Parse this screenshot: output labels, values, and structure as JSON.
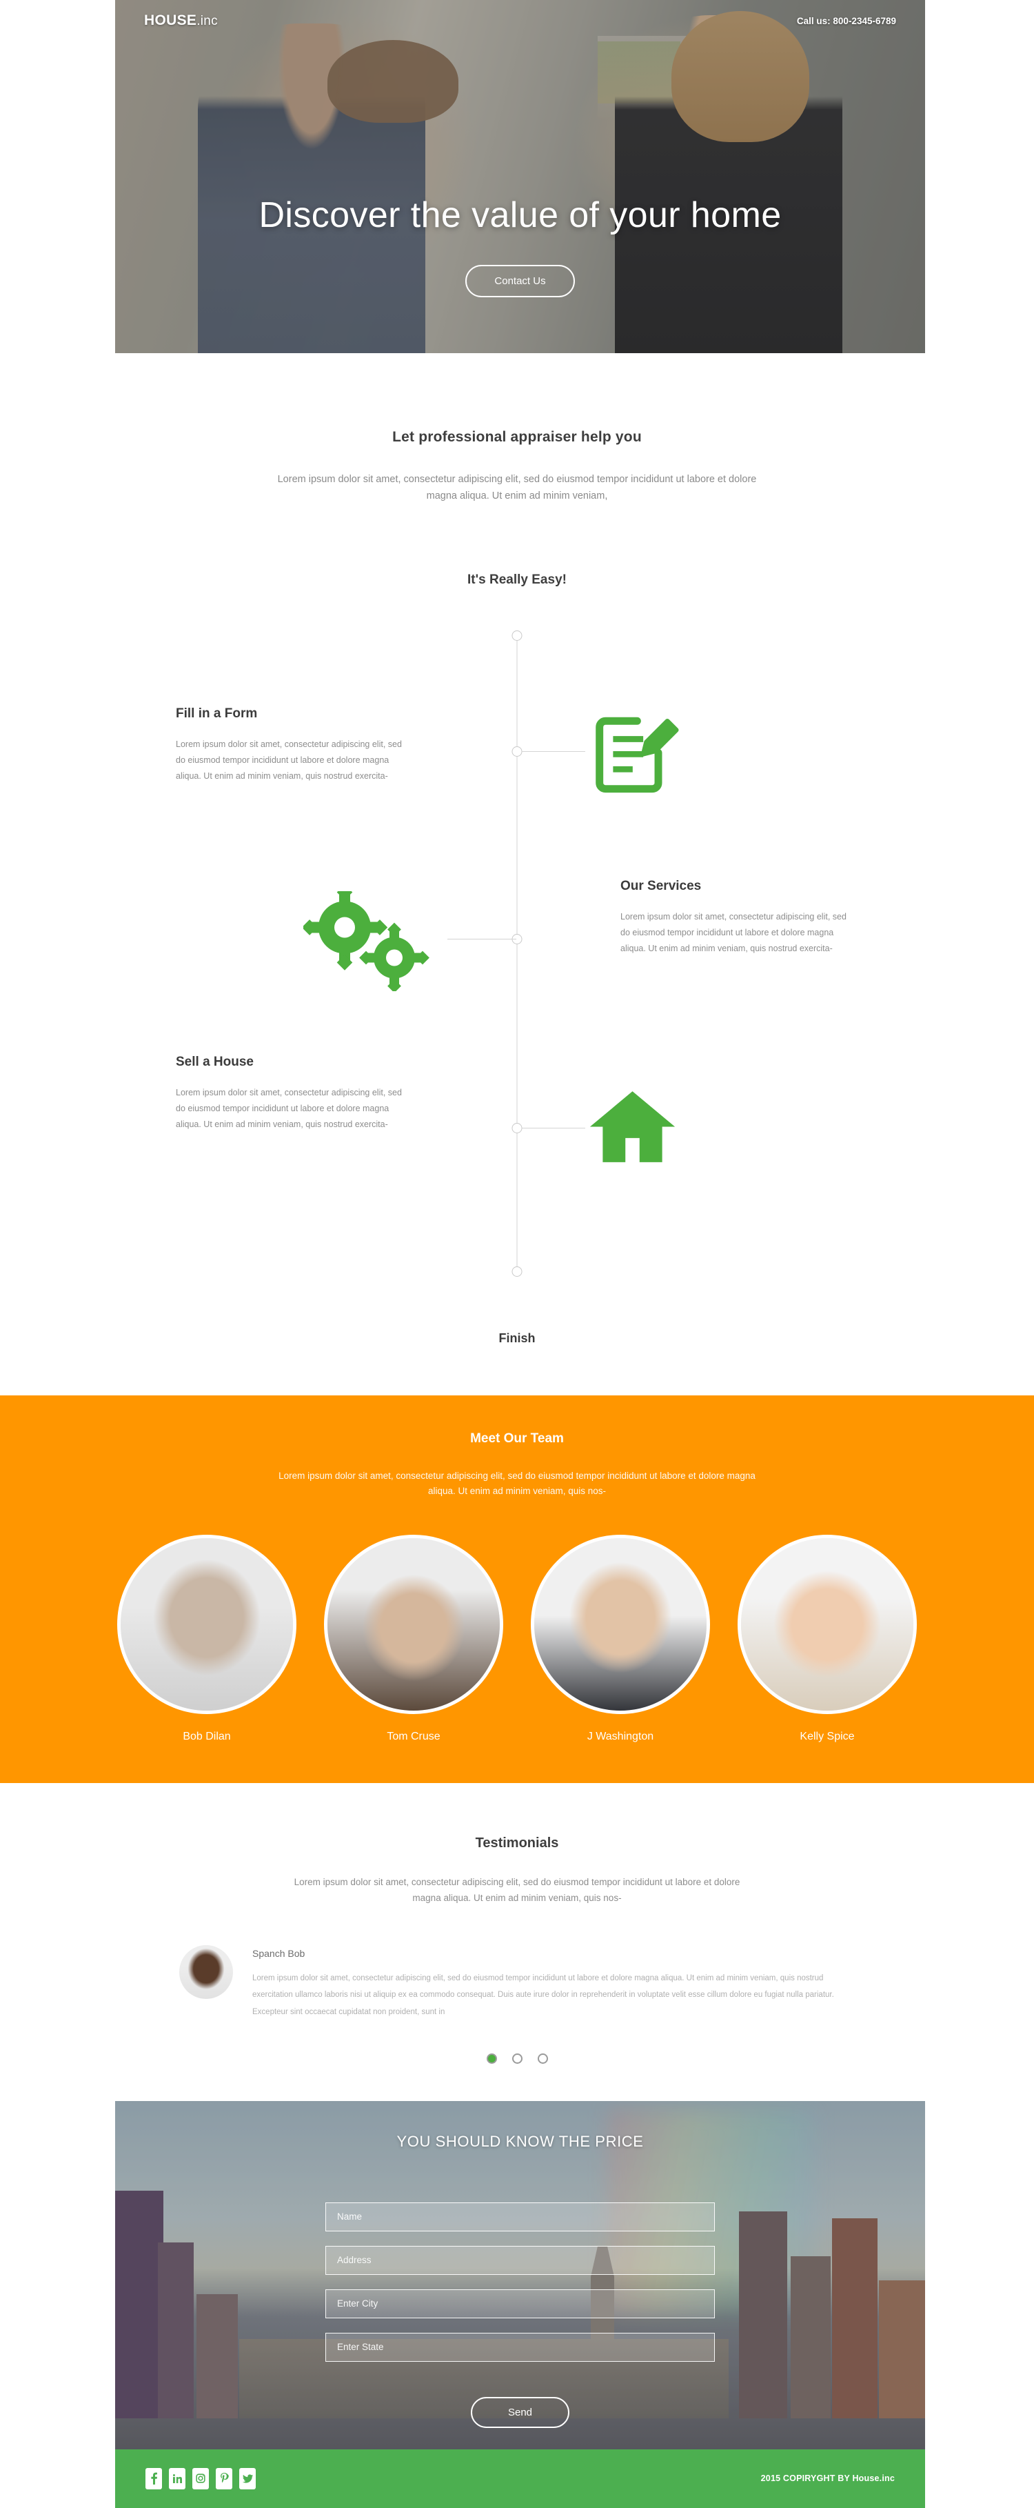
{
  "hero": {
    "logo_main": "HOUSE",
    "logo_suffix": ".inc",
    "phone": "Call us: 800-2345-6789",
    "headline": "Discover the value of your home",
    "cta_label": "Contact Us"
  },
  "intro": {
    "title": "Let professional appraiser help you",
    "text": "Lorem ipsum dolor sit amet, consectetur adipiscing elit, sed do eiusmod tempor incididunt ut labore et dolore magna aliqua. Ut enim ad minim veniam,"
  },
  "easy": {
    "title": "It's Really Easy!",
    "finish_label": "Finish",
    "steps": [
      {
        "title": "Fill in a Form",
        "text": "Lorem ipsum dolor sit amet, consectetur adipiscing elit, sed do eiusmod tempor incididunt ut labore et dolore magna aliqua. Ut enim ad minim veniam, quis nostrud exercita-",
        "icon": "pencil-form-icon"
      },
      {
        "title": "Our Services",
        "text": "Lorem ipsum dolor sit amet, consectetur adipiscing elit, sed do eiusmod tempor incididunt ut labore et dolore magna aliqua. Ut enim ad minim veniam, quis nostrud exercita-",
        "icon": "gears-icon"
      },
      {
        "title": "Sell a House",
        "text": "Lorem ipsum dolor sit amet, consectetur adipiscing elit, sed do eiusmod tempor incididunt ut labore et dolore magna aliqua. Ut enim ad minim veniam, quis nostrud exercita-",
        "icon": "house-icon"
      }
    ]
  },
  "team": {
    "title": "Meet Our Team",
    "text": "Lorem ipsum dolor sit amet, consectetur adipiscing elit, sed do eiusmod tempor incididunt ut labore et dolore magna aliqua. Ut enim ad minim veniam, quis nos-",
    "members": [
      {
        "name": "Bob Dilan"
      },
      {
        "name": "Tom Cruse"
      },
      {
        "name": "J Washington"
      },
      {
        "name": "Kelly Spice"
      }
    ],
    "bg_color": "#ff9600"
  },
  "testimonials": {
    "title": "Testimonials",
    "intro": "Lorem ipsum dolor sit amet, consectetur adipiscing elit, sed do eiusmod tempor incididunt ut labore et dolore magna aliqua. Ut enim ad minim veniam, quis nos-",
    "author": "Spanch Bob",
    "quote": "Lorem ipsum dolor sit amet, consectetur adipiscing elit, sed do eiusmod tempor incididunt ut labore et dolore magna aliqua. Ut enim ad minim veniam, quis nostrud exercitation ullamco laboris nisi ut aliquip ex ea commodo consequat. Duis aute irure dolor in reprehenderit in voluptate velit esse cillum dolore eu fugiat nulla pariatur. Excepteur sint occaecat cupidatat non proident, sunt in",
    "slides": 3,
    "active_slide": 1,
    "active_dot_color": "#4caf3d"
  },
  "contact": {
    "title": "YOU SHOULD KNOW THE PRICE",
    "fields": [
      {
        "name": "name",
        "placeholder": "Name",
        "value": ""
      },
      {
        "name": "address",
        "placeholder": "Address",
        "value": ""
      },
      {
        "name": "city",
        "placeholder": "Enter City",
        "value": ""
      },
      {
        "name": "state",
        "placeholder": "Enter State",
        "value": ""
      }
    ],
    "submit_label": "Send"
  },
  "footer": {
    "copyright": "2015 COPIRYGHT BY House.inc",
    "bg_color": "#4caf50",
    "social": [
      {
        "icon": "facebook-icon",
        "glyph": "f"
      },
      {
        "icon": "linkedin-icon",
        "glyph": "in"
      },
      {
        "icon": "instagram-icon",
        "glyph": "◎"
      },
      {
        "icon": "pinterest-icon",
        "glyph": "P"
      },
      {
        "icon": "twitter-icon",
        "glyph": "🐦"
      }
    ]
  }
}
